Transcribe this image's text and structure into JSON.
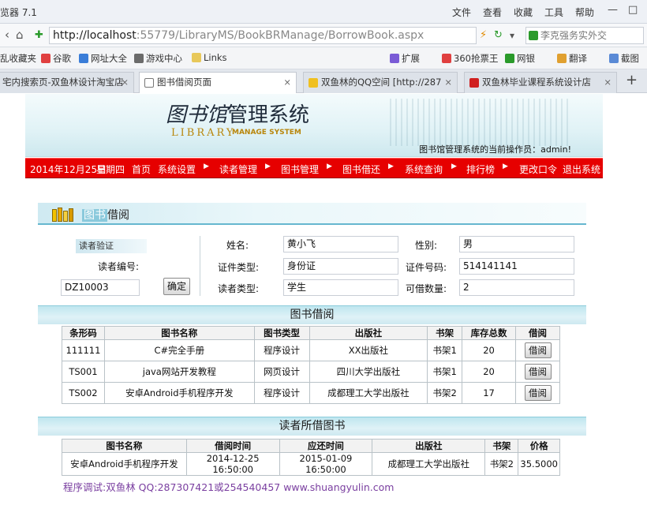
{
  "browser": {
    "app_title": "览器 7.1",
    "menu": [
      "文件",
      "查看",
      "收藏",
      "工具",
      "帮助"
    ],
    "url_host": "http://localhost",
    "url_rest": ":55779/LibraryMS/BookBRManage/BorrowBook.aspx",
    "search_text": "李克强务实外交",
    "favorites": [
      "乱收藏夹",
      "谷歌",
      "网址大全",
      "游戏中心",
      "Links",
      "扩展",
      "360抢票王",
      "网银",
      "翻译",
      "截图"
    ],
    "tabs": [
      {
        "label": "宅内搜索页-双鱼林设计淘宝店",
        "active": false
      },
      {
        "label": "图书借阅页面",
        "active": true
      },
      {
        "label": "双鱼林的QQ空间 [http://287",
        "active": false
      },
      {
        "label": "双鱼林毕业课程系统设计店",
        "active": false
      }
    ],
    "new_tab": "+"
  },
  "header": {
    "logo_cn_art": "图书馆",
    "logo_cn": "管理系统",
    "logo_en1": "LIBRARY",
    "logo_en2": "MANAGE SYSTEM",
    "operator_text": "图书馆管理系统的当前操作员：admin!"
  },
  "nav": {
    "date": "2014年12月25日",
    "weekday": "星期四",
    "items": [
      "首页",
      "系统设置",
      "读者管理",
      "图书管理",
      "图书借还",
      "系统查询",
      "排行榜",
      "更改口令",
      "退出系统"
    ]
  },
  "section": {
    "title_hl": "图书",
    "title": "借阅"
  },
  "reader_form": {
    "verify_label": "读者验证",
    "reader_no_label": "读者编号:",
    "reader_no_value": "DZ10003",
    "confirm_button": "确定",
    "name_label": "姓名:",
    "name_value": "黄小飞",
    "gender_label": "性别:",
    "gender_value": "男",
    "id_type_label": "证件类型:",
    "id_type_value": "身份证",
    "id_no_label": "证件号码:",
    "id_no_value": "514141141",
    "reader_type_label": "读者类型:",
    "reader_type_value": "学生",
    "borrow_quota_label": "可借数量:",
    "borrow_quota_value": "2"
  },
  "book_table": {
    "title": "图书借阅",
    "columns": [
      "条形码",
      "图书名称",
      "图书类型",
      "出版社",
      "书架",
      "库存总数",
      "借阅"
    ],
    "rows": [
      {
        "barcode": "111111",
        "name": "C#完全手册",
        "type": "程序设计",
        "publisher": "XX出版社",
        "shelf": "书架1",
        "stock": "20",
        "action": "借阅"
      },
      {
        "barcode": "TS001",
        "name": "java网站开发教程",
        "type": "网页设计",
        "publisher": "四川大学出版社",
        "shelf": "书架1",
        "stock": "20",
        "action": "借阅"
      },
      {
        "barcode": "TS002",
        "name": "安卓Android手机程序开发",
        "type": "程序设计",
        "publisher": "成都理工大学出版社",
        "shelf": "书架2",
        "stock": "17",
        "action": "借阅"
      }
    ]
  },
  "borrowed_table": {
    "title": "读者所借图书",
    "columns": [
      "图书名称",
      "借阅时间",
      "应还时间",
      "出版社",
      "书架",
      "价格"
    ],
    "rows": [
      {
        "name": "安卓Android手机程序开发",
        "borrow_time": "2014-12-25 16:50:00",
        "due_time": "2015-01-09 16:50:00",
        "publisher": "成都理工大学出版社",
        "shelf": "书架2",
        "price": "35.5000"
      }
    ]
  },
  "footer": {
    "text": "程序调试:双鱼林 QQ:287307421或254540457 www.shuangyulin.com"
  },
  "colors": {
    "nav_red": "#e60000",
    "banner_teal": "#cde8ee",
    "footer_purple": "#7a3fa0"
  }
}
